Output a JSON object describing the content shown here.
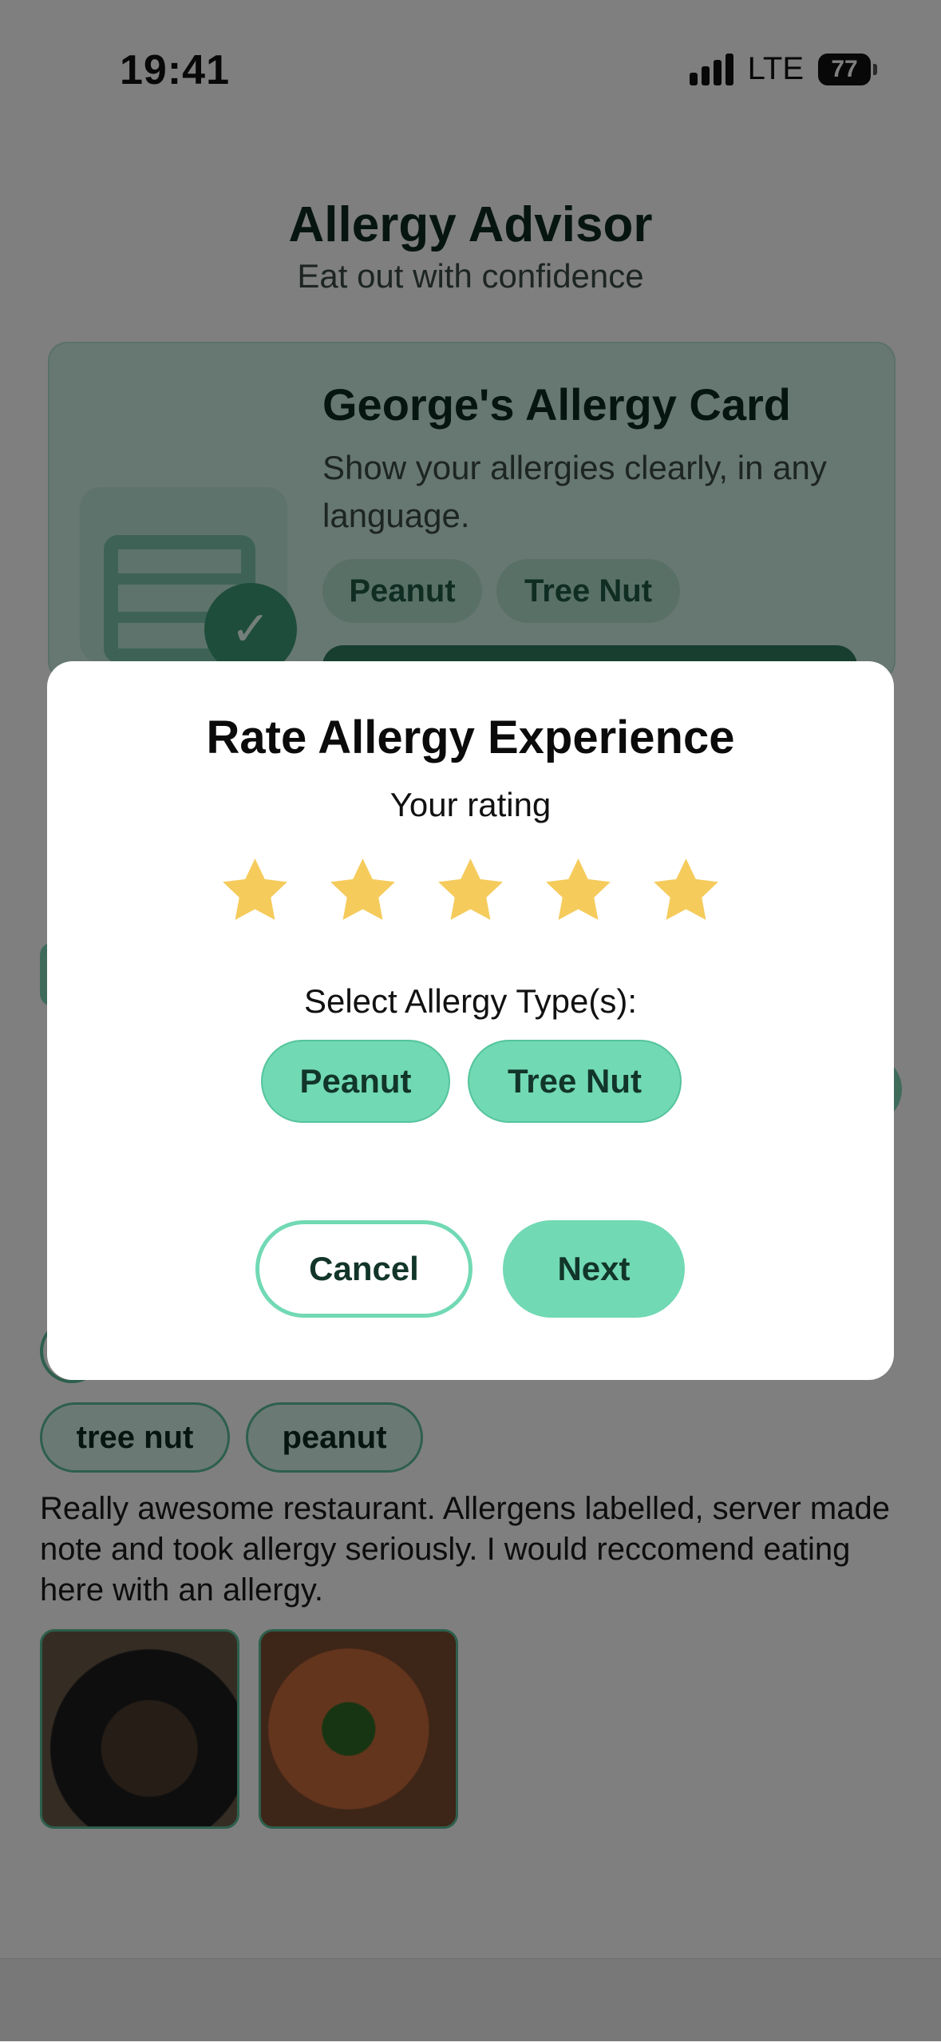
{
  "status_bar": {
    "time": "19:41",
    "network": "LTE",
    "battery": "77"
  },
  "header": {
    "title": "Allergy Advisor",
    "subtitle": "Eat out with confidence"
  },
  "allergy_card": {
    "title": "George's Allergy Card",
    "description": "Show your allergies clearly, in any language.",
    "chips": [
      "Peanut",
      "Tree Nut"
    ]
  },
  "review": {
    "tags": [
      "tree nut",
      "peanut"
    ],
    "text": "Really awesome restaurant. Allergens labelled, server made note and took allergy seriously. I would reccomend eating here with an allergy.",
    "photos": [
      "food-photo",
      "food-photo"
    ]
  },
  "modal": {
    "title": "Rate Allergy Experience",
    "rating_label": "Your rating",
    "rating": 5,
    "rating_max": 5,
    "star_color": "#F5CB5C",
    "types_label": "Select Allergy Type(s):",
    "types": [
      "Peanut",
      "Tree Nut"
    ],
    "cancel_label": "Cancel",
    "next_label": "Next"
  },
  "colors": {
    "accent": "#71D9B4",
    "dark_green": "#2F7D5F",
    "text": "#0E2A22"
  }
}
